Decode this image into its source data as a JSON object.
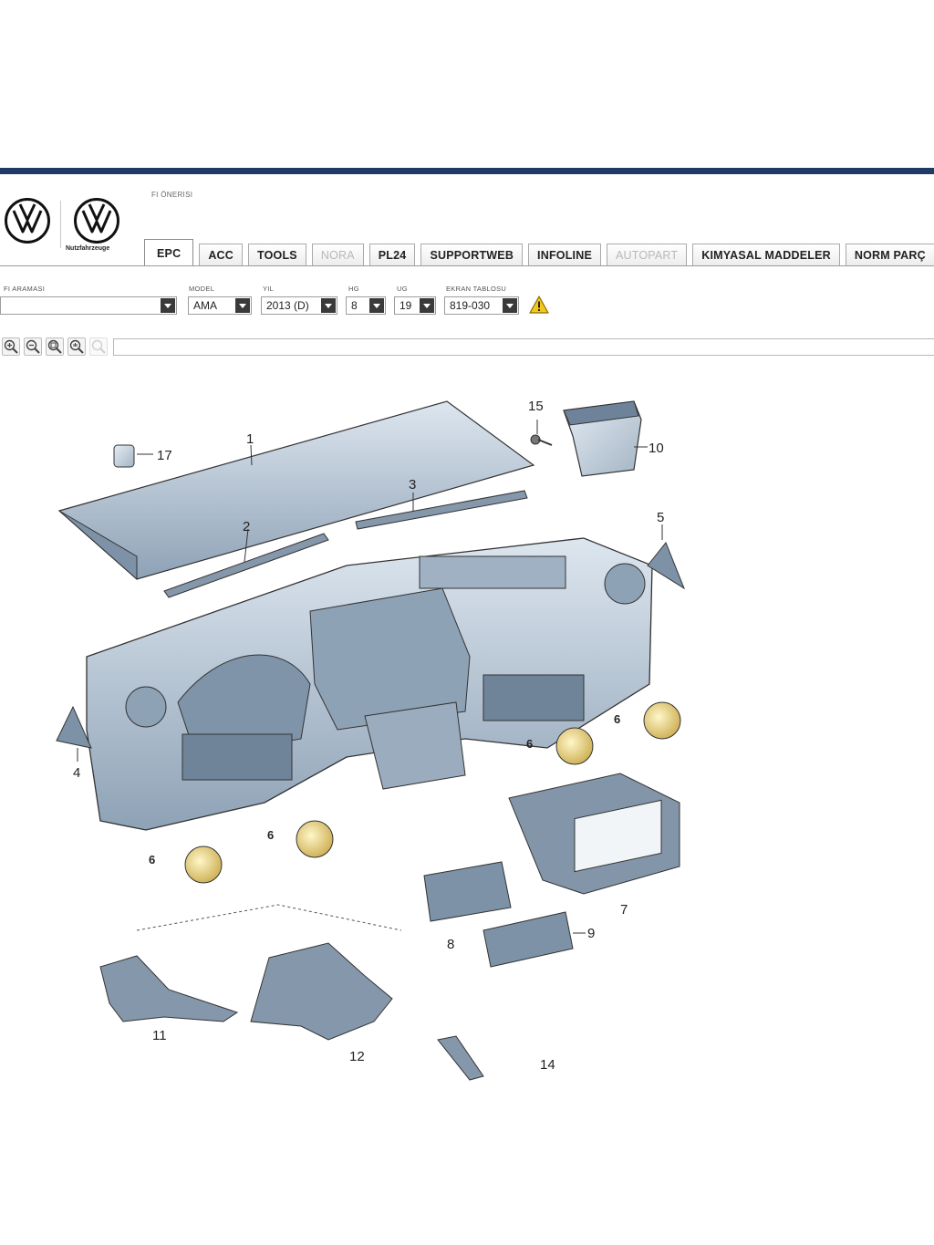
{
  "header": {
    "brand_subtitle": "Nutzfahrzeuge",
    "fi_onerisi_label": "FI ÖNERISI"
  },
  "tabs": [
    {
      "label": "EPC",
      "state": "active"
    },
    {
      "label": "ACC",
      "state": "normal"
    },
    {
      "label": "TOOLS",
      "state": "normal"
    },
    {
      "label": "NORA",
      "state": "disabled"
    },
    {
      "label": "PL24",
      "state": "normal"
    },
    {
      "label": "SUPPORTWEB",
      "state": "normal"
    },
    {
      "label": "INFOLINE",
      "state": "normal"
    },
    {
      "label": "AUTOPART",
      "state": "disabled"
    },
    {
      "label": "KIMYASAL MADDELER",
      "state": "normal"
    },
    {
      "label": "NORM PARÇ",
      "state": "normal"
    }
  ],
  "filters": {
    "fi_aramasi": {
      "label": "FI ARAMASI",
      "value": ""
    },
    "model": {
      "label": "MODEL",
      "value": "AMA"
    },
    "yil": {
      "label": "YIL",
      "value": "2013 (D)"
    },
    "hg": {
      "label": "HG",
      "value": "8"
    },
    "ug": {
      "label": "UG",
      "value": "19"
    },
    "ekran_tablosu": {
      "label": "EKRAN TABLOSU",
      "value": "819-030"
    }
  },
  "toolbar": {
    "icons": [
      "zoom-in-icon",
      "zoom-out-icon",
      "zoom-fit-icon",
      "zoom-hand-icon",
      "zoom-disabled-icon"
    ]
  },
  "diagram": {
    "callouts": [
      "1",
      "2",
      "3",
      "4",
      "5",
      "6",
      "6",
      "6",
      "6",
      "7",
      "8",
      "9",
      "10",
      "11",
      "12",
      "14",
      "15",
      "17"
    ]
  },
  "colors": {
    "header_bar": "#1f3b66",
    "part_fill": "#a8b8c8",
    "highlight": "#e6d27a"
  }
}
